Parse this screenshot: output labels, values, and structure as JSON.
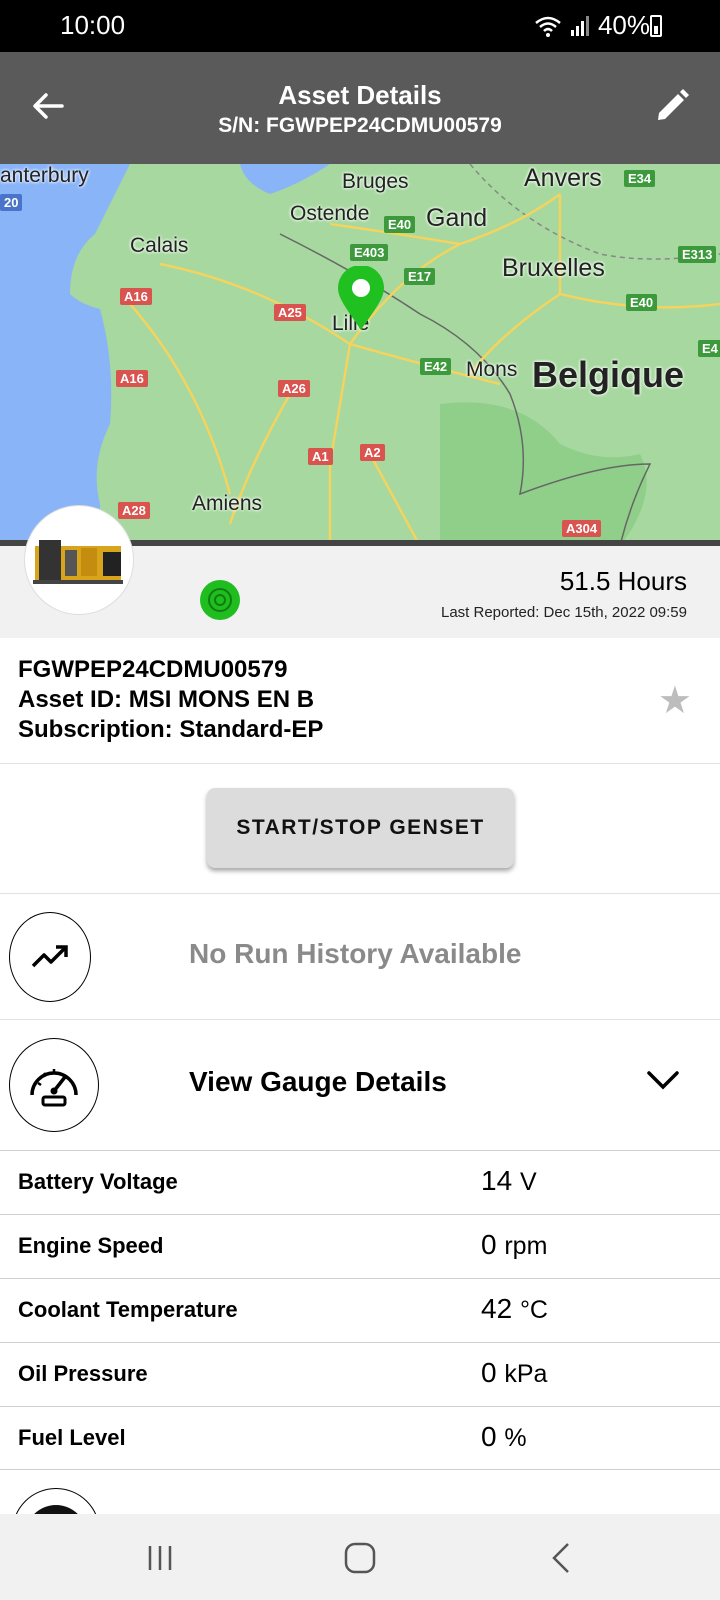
{
  "status_bar": {
    "time": "10:00",
    "battery": "40%",
    "icons": [
      "wifi-icon",
      "signal-icon",
      "battery-charging-icon"
    ]
  },
  "app_bar": {
    "title": "Asset Details",
    "subtitle": "S/N: FGWPEP24CDMU00579",
    "back_icon": "arrow-left-icon",
    "edit_icon": "pencil-icon"
  },
  "map": {
    "labels": {
      "canterbury": "anterbury",
      "bruges": "Bruges",
      "anvers": "Anvers",
      "ostende": "Ostende",
      "gand": "Gand",
      "calais": "Calais",
      "bruxelles": "Bruxelles",
      "lille": "Lille",
      "mons": "Mons",
      "belgique": "Belgique",
      "amiens": "Amiens"
    },
    "roads": {
      "e34": "E34",
      "e40a": "E40",
      "e403": "E403",
      "e17": "E17",
      "e313": "E313",
      "a16a": "A16",
      "a25": "A25",
      "e40b": "E40",
      "e42": "E42",
      "a16b": "A16",
      "a26": "A26",
      "a1": "A1",
      "a2": "A2",
      "a28": "A28",
      "a304": "A304",
      "left20": "20",
      "e4": "E4"
    },
    "pin_color": "#20c020"
  },
  "summary": {
    "hours": "51.5 Hours",
    "last_reported": "Last Reported: Dec 15th, 2022 09:59",
    "status_color": "#1fbd1f"
  },
  "asset": {
    "serial": "FGWPEP24CDMU00579",
    "asset_id": "Asset ID: MSI MONS EN B",
    "subscription": "Subscription: Standard-EP",
    "favorite_icon": "star-icon"
  },
  "actions": {
    "start_stop": "START/STOP GENSET"
  },
  "run_history": {
    "text": "No Run History Available",
    "icon": "trend-up-icon"
  },
  "gauges": {
    "header": "View Gauge Details",
    "icon": "speedometer-icon",
    "rows": [
      {
        "label": "Battery Voltage",
        "value": "14",
        "unit": "V"
      },
      {
        "label": "Engine Speed",
        "value": "0",
        "unit": "rpm"
      },
      {
        "label": "Coolant Temperature",
        "value": "42",
        "unit": "°C"
      },
      {
        "label": "Oil Pressure",
        "value": "0",
        "unit": "kPa"
      },
      {
        "label": "Fuel Level",
        "value": "0",
        "unit": "%"
      }
    ]
  },
  "nav_bar": {
    "recents_icon": "recents-icon",
    "home_icon": "home-icon",
    "back_icon": "back-chevron-icon"
  }
}
